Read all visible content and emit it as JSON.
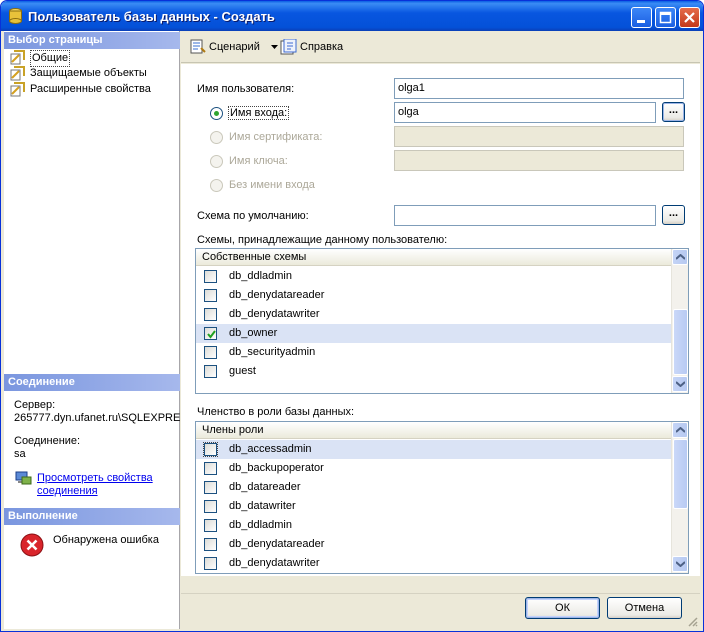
{
  "window": {
    "title": "Пользователь базы данных - Создать"
  },
  "left": {
    "select_page_header": "Выбор страницы",
    "nav_items": [
      "Общие",
      "Защищаемые объекты",
      "Расширенные свойства"
    ],
    "connection_header": "Соединение",
    "server_label": "Сервер:",
    "server_value": "265777.dyn.ufanet.ru\\SQLEXPRE",
    "connection_label": "Соединение:",
    "connection_value": "sa",
    "view_link": "Просмотреть свойства соединения",
    "progress_header": "Выполнение",
    "status_text": "Обнаружена ошибка"
  },
  "toolbar": {
    "script_label": "Сценарий",
    "help_label": "Справка"
  },
  "form": {
    "username_label": "Имя пользователя:",
    "username_value": "olga1",
    "login_label": "Имя входа:",
    "login_value": "olga",
    "cert_label": "Имя сертификата:",
    "key_label": "Имя ключа:",
    "nologin_label": "Без имени входа",
    "default_schema_label": "Схема по умолчанию:",
    "default_schema_value": "",
    "browse_label": "...",
    "schemas_caption": "Схемы, принадлежащие данному пользователю:",
    "schemas_header": "Собственные схемы",
    "schemas": [
      {
        "name": "db_ddladmin",
        "checked": false
      },
      {
        "name": "db_denydatareader",
        "checked": false
      },
      {
        "name": "db_denydatawriter",
        "checked": false
      },
      {
        "name": "db_owner",
        "checked": true
      },
      {
        "name": "db_securityadmin",
        "checked": false
      },
      {
        "name": "guest",
        "checked": false
      }
    ],
    "roles_caption": "Членство в роли базы данных:",
    "roles_header": "Члены роли",
    "roles": [
      {
        "name": "db_accessadmin",
        "checked": false
      },
      {
        "name": "db_backupoperator",
        "checked": false
      },
      {
        "name": "db_datareader",
        "checked": false
      },
      {
        "name": "db_datawriter",
        "checked": false
      },
      {
        "name": "db_ddladmin",
        "checked": false
      },
      {
        "name": "db_denydatareader",
        "checked": false
      },
      {
        "name": "db_denydatawriter",
        "checked": false
      }
    ]
  },
  "buttons": {
    "ok": "ОК",
    "cancel": "Отмена"
  },
  "colors": {
    "titlebar": "#0856e0",
    "pane_header": "#7a96df",
    "selected_row": "#dae3f5",
    "link": "#0000ee",
    "error": "#d9252b"
  }
}
